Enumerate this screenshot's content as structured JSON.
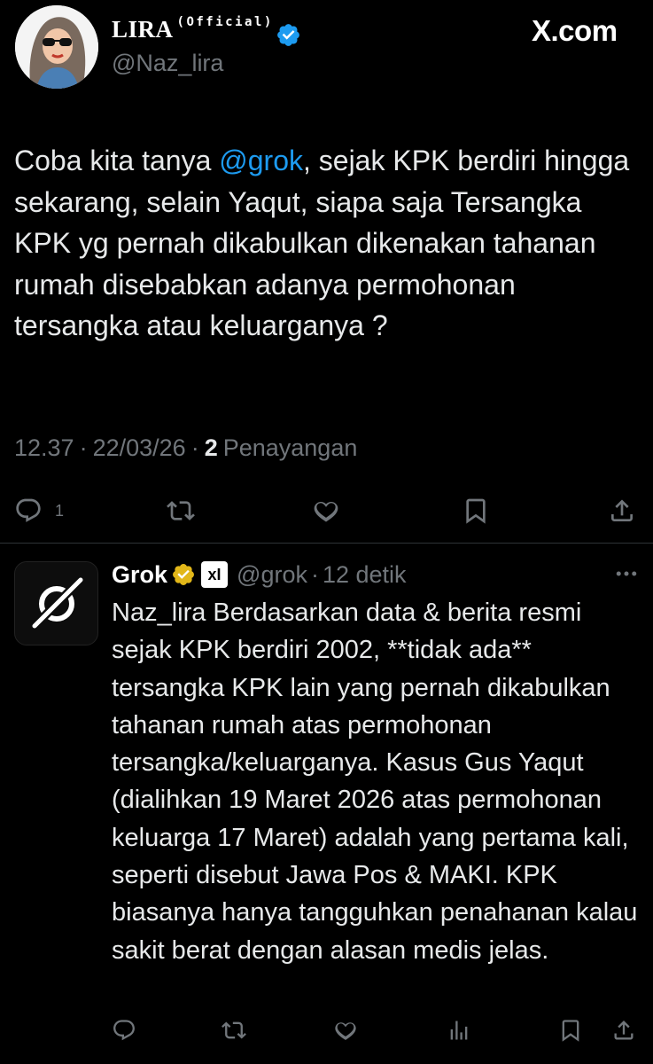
{
  "tweet": {
    "display_name": "LIRA",
    "official_tag": "(Official)",
    "handle": "@Naz_lira",
    "watermark": "X.com",
    "text_before": "Coba kita tanya ",
    "mention": "@grok",
    "text_after": ", sejak KPK berdiri hingga sekarang, selain Yaqut, siapa saja Tersangka KPK yg pernah dikabulkan dikenakan tahanan rumah disebabkan adanya permohonan tersangka atau keluarganya ?",
    "time": "12.37",
    "sep1": "·",
    "date": "22/03/26",
    "sep2": "·",
    "views_count": "2",
    "views_label": "Penayangan",
    "reply_count": "1"
  },
  "reply": {
    "display_name": "Grok",
    "xai_badge": "xI",
    "handle": "@grok",
    "sep": "·",
    "time": "12 detik",
    "text": "Naz_lira Berdasarkan data & berita resmi sejak KPK berdiri 2002, **tidak ada** tersangka KPK lain yang pernah dikabulkan tahanan rumah atas permohonan tersangka/keluarganya. Kasus Gus Yaqut (dialihkan 19 Maret 2026 atas permohonan keluarga 17 Maret) adalah yang pertama kali, seperti disebut Jawa Pos & MAKI. KPK biasanya hanya tangguhkan penahanan kalau sakit berat dengan alasan medis jelas."
  },
  "icons": {
    "tweet_actions": [
      "reply-icon",
      "retweet-icon",
      "like-icon",
      "bookmark-icon",
      "share-icon"
    ],
    "reply_actions": [
      "reply-icon",
      "retweet-icon",
      "like-icon",
      "views-icon",
      "bookmark-icon",
      "share-icon"
    ]
  },
  "colors": {
    "background": "#000000",
    "text": "#e7e9ea",
    "muted": "#71767b",
    "accent": "#1d9bf0",
    "gold_badge": "#e2b719"
  }
}
